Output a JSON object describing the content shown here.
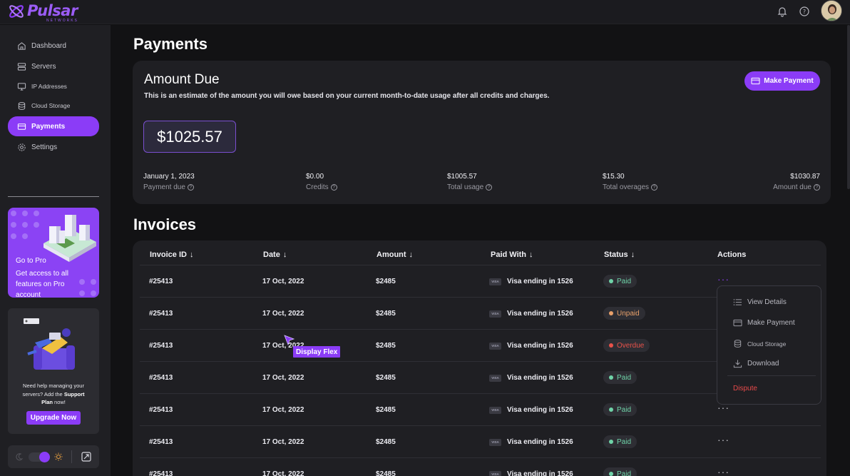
{
  "app": {
    "logo_text": "Pulsar",
    "logo_sub": "NETWORKS"
  },
  "sidebar": {
    "items": [
      {
        "label": "Dashboard",
        "icon": "home-icon"
      },
      {
        "label": "Servers",
        "icon": "servers-icon"
      },
      {
        "label": "IP Addresses",
        "icon": "monitor-icon"
      },
      {
        "label": "Cloud Storage",
        "icon": "database-icon"
      },
      {
        "label": "Payments",
        "icon": "card-icon",
        "active": true
      },
      {
        "label": "Settings",
        "icon": "gear-icon"
      }
    ],
    "pro": {
      "title": "Go to Pro",
      "text": "Get access to all features on Pro account"
    },
    "support": {
      "text_1": "Need help managing your servers? Add the ",
      "plan": "Support Plan",
      "text_2": " now!",
      "button": "Upgrade Now"
    }
  },
  "main": {
    "title": "Payments",
    "amount_due": {
      "title": "Amount Due",
      "description": "This is an estimate of the amount you will owe based on your current month-to-date usage after all credits and charges.",
      "button": "Make Payment",
      "amount": "$1025.57",
      "stats": [
        {
          "value": "January 1, 2023",
          "label": "Payment due"
        },
        {
          "value": "$0.00",
          "label": "Credits"
        },
        {
          "value": "$1005.57",
          "label": "Total usage"
        },
        {
          "value": "$15.30",
          "label": "Total overages"
        },
        {
          "value": "$1030.87",
          "label": "Amount due"
        }
      ]
    },
    "invoices": {
      "title": "Invoices",
      "columns": [
        "Invoice ID",
        "Date",
        "Amount",
        "Paid With",
        "Status",
        "Actions"
      ],
      "rows": [
        {
          "id": "#25413",
          "date": "17 Oct, 2022",
          "amount": "$2485",
          "paid_with": "Visa ending in 1526",
          "status": "Paid"
        },
        {
          "id": "#25413",
          "date": "17 Oct, 2022",
          "amount": "$2485",
          "paid_with": "Visa ending in 1526",
          "status": "Unpaid"
        },
        {
          "id": "#25413",
          "date": "17 Oct, 2022",
          "amount": "$2485",
          "paid_with": "Visa ending in 1526",
          "status": "Overdue"
        },
        {
          "id": "#25413",
          "date": "17 Oct, 2022",
          "amount": "$2485",
          "paid_with": "Visa ending in 1526",
          "status": "Paid"
        },
        {
          "id": "#25413",
          "date": "17 Oct, 2022",
          "amount": "$2485",
          "paid_with": "Visa ending in 1526",
          "status": "Paid"
        },
        {
          "id": "#25413",
          "date": "17 Oct, 2022",
          "amount": "$2485",
          "paid_with": "Visa ending in 1526",
          "status": "Paid"
        },
        {
          "id": "#25413",
          "date": "17 Oct, 2022",
          "amount": "$2485",
          "paid_with": "Visa ending in 1526",
          "status": "Paid"
        }
      ],
      "visa_label": "VISA"
    },
    "actions_menu": {
      "items": [
        "View Details",
        "Make Payment",
        "Cloud Storage",
        "Download"
      ],
      "danger": "Dispute"
    }
  },
  "overlay": {
    "tooltip": "Display Flex"
  },
  "colors": {
    "accent": "#8b3cf7",
    "paid": "#6fd3a8",
    "unpaid": "#e8a06a",
    "overdue": "#e8524a"
  }
}
